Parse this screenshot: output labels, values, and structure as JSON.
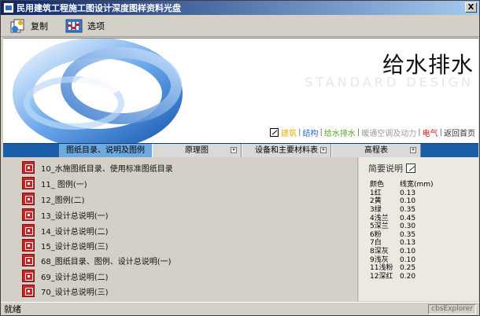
{
  "window": {
    "title": "民用建筑工程施工图设计深度图样资料光盘",
    "close_label": "X"
  },
  "toolbar": {
    "copy_label": "复制",
    "options_label": "选项"
  },
  "banner": {
    "title": "给水排水",
    "ghost_text": "STANDARD DESIGN",
    "nav": [
      {
        "label": "建筑",
        "color": "#e8b000"
      },
      {
        "label": "结构",
        "color": "#2a6cc8"
      },
      {
        "label": "给水排水",
        "color": "#5aa02c"
      },
      {
        "label": "暖通空调及动力",
        "color": "#9a9a9a"
      },
      {
        "label": "电气",
        "color": "#d02020"
      },
      {
        "label": "返回首页",
        "color": "#333333"
      }
    ]
  },
  "tabs": [
    {
      "label": "图纸目录、说明及图例",
      "active": true
    },
    {
      "label": "原理图",
      "active": false
    },
    {
      "label": "设备和主要材料表",
      "active": false
    },
    {
      "label": "高程表",
      "active": false
    }
  ],
  "files": [
    "10_水施图纸目录、使用标准图纸目录",
    "11_ 图例(一)",
    "12_图例(二)",
    "13_设计总说明(一)",
    "14_设计总说明(二)",
    "15_设计总说明(三)",
    "68_图纸目录、图例、设计总说明(一)",
    "69_设计总说明(二)",
    "70_设计总说明(三)"
  ],
  "side": {
    "title": "简要说明",
    "headers": [
      "颜色",
      "线宽(mm)"
    ],
    "rows": [
      [
        "1红",
        "0.13"
      ],
      [
        "2黄",
        "0.10"
      ],
      [
        "3绿",
        "0.35"
      ],
      [
        "4浅兰",
        "0.45"
      ],
      [
        "5深兰",
        "0.30"
      ],
      [
        "6粉",
        "0.35"
      ],
      [
        "7白",
        "0.13"
      ],
      [
        "8深灰",
        "0.10"
      ],
      [
        "9浅灰",
        "0.10"
      ],
      [
        "11浅粉",
        "0.25"
      ],
      [
        "12深红",
        "0.20"
      ]
    ]
  },
  "status": {
    "message": "就绪",
    "right_label": "cbsExplorer"
  }
}
